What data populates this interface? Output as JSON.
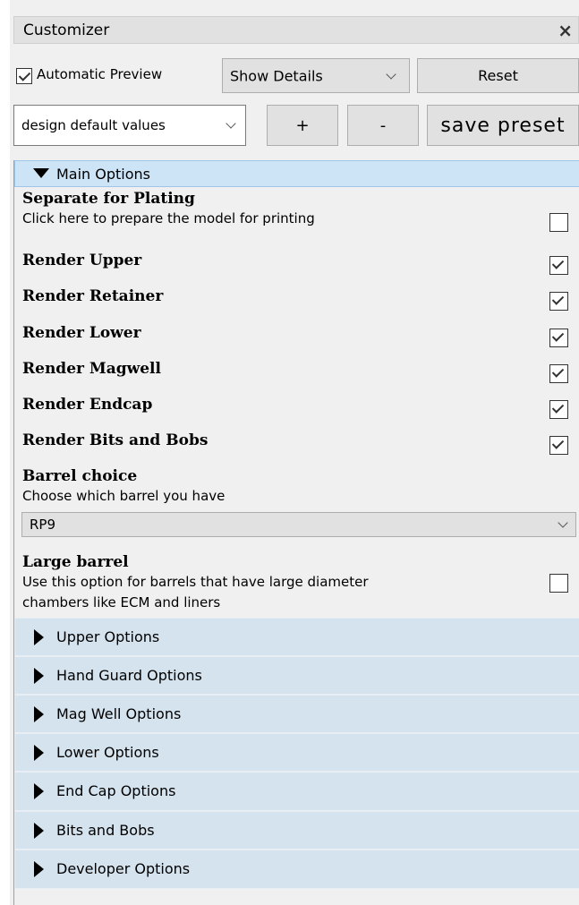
{
  "panel": {
    "title": "Customizer",
    "close_icon": "close-icon"
  },
  "toolbar": {
    "auto_preview_label": "Automatic Preview",
    "auto_preview_checked": true,
    "details_select": "Show Details",
    "reset_label": "Reset",
    "preset_select": "design default values",
    "add_label": "+",
    "remove_label": "-",
    "save_label": "save preset"
  },
  "main": {
    "header": "Main Options",
    "options": [
      {
        "title": "Separate for Plating",
        "desc": "Click here to prepare the model for printing",
        "checked": false
      },
      {
        "title": "Render Upper",
        "checked": true
      },
      {
        "title": "Render Retainer",
        "checked": true
      },
      {
        "title": "Render Lower",
        "checked": true
      },
      {
        "title": "Render Magwell",
        "checked": true
      },
      {
        "title": "Render Endcap",
        "checked": true
      },
      {
        "title": "Render Bits and Bobs",
        "checked": true
      }
    ],
    "barrel": {
      "title": "Barrel choice",
      "desc": "Choose which barrel you have",
      "value": "RP9"
    },
    "large_barrel": {
      "title": "Large barrel",
      "desc1": "Use this option for barrels that have large diameter",
      "desc2": "chambers like ECM and liners",
      "checked": false
    }
  },
  "sections": [
    "Upper Options",
    "Hand Guard Options",
    "Mag Well Options",
    "Lower Options",
    "End Cap Options",
    "Bits and Bobs",
    "Developer Options"
  ]
}
